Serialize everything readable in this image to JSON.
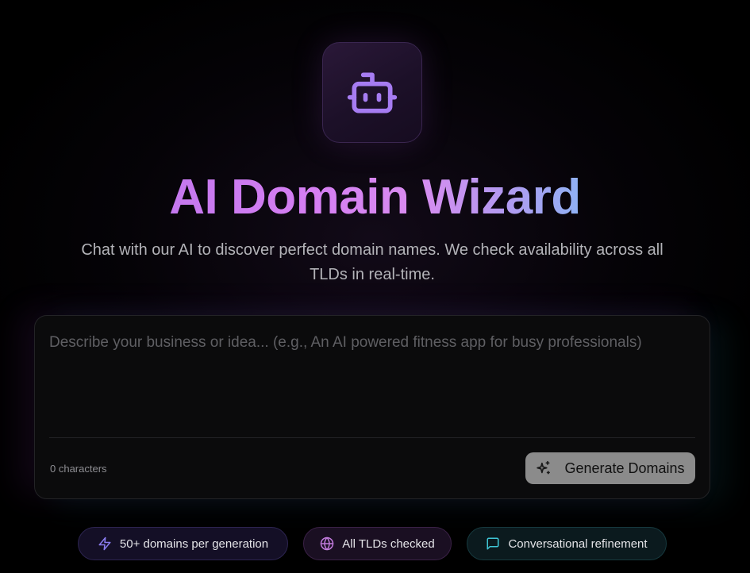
{
  "header": {
    "logo_icon": "robot-icon",
    "title": "AI Domain Wizard",
    "subtitle": "Chat with our AI to discover perfect domain names. We check availability across all TLDs in real-time."
  },
  "prompt": {
    "value": "",
    "placeholder": "Describe your business or idea... (e.g., An AI powered fitness app for busy professionals)",
    "char_count_label": "0 characters",
    "generate_label": "Generate Domains",
    "generate_icon": "sparkles-icon"
  },
  "features": [
    {
      "label": "50+ domains per generation",
      "icon": "lightning-icon",
      "color": "#8a7cf0"
    },
    {
      "label": "All TLDs checked",
      "icon": "globe-icon",
      "color": "#c17bdc"
    },
    {
      "label": "Conversational refinement",
      "icon": "chat-bubble-icon",
      "color": "#3fc6d6"
    }
  ],
  "colors": {
    "background": "#000000",
    "accent_purple": "#a67cf2",
    "title_gradient_start": "#c478ee",
    "title_gradient_end": "#8fb2f4",
    "button_background": "#8b8b8b"
  }
}
